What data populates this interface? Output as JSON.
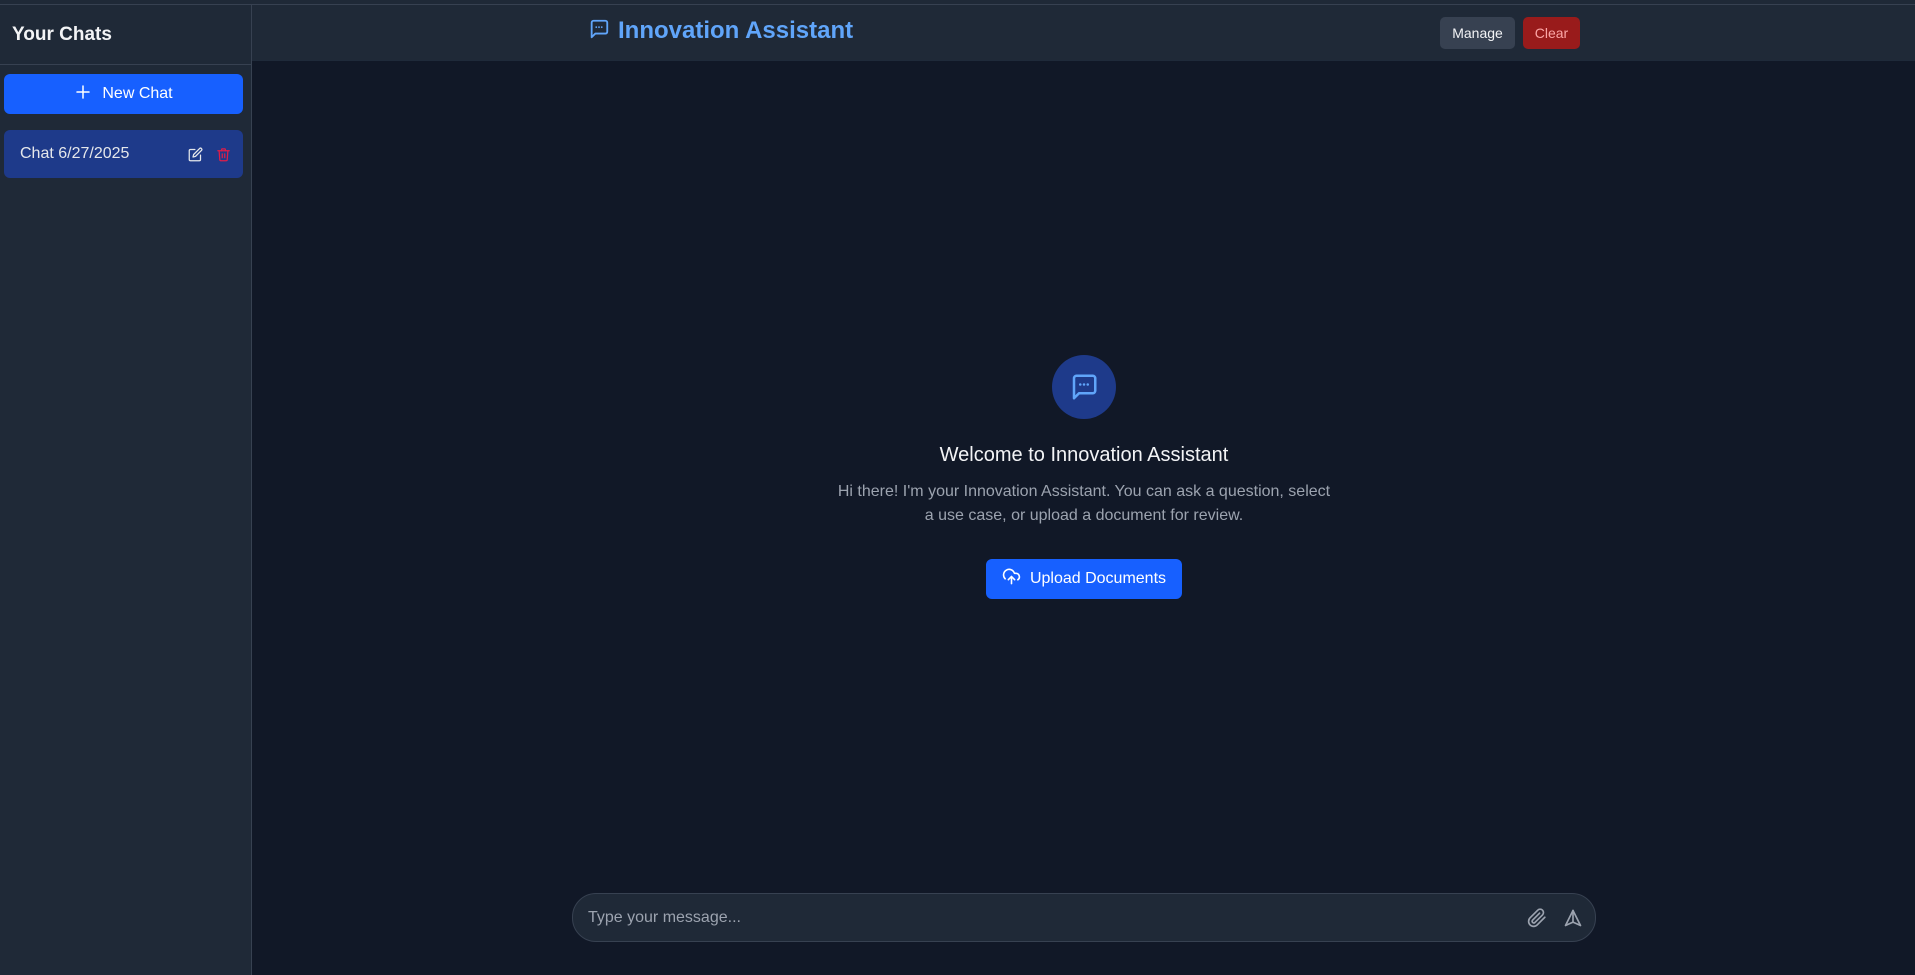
{
  "sidebar": {
    "title": "Your Chats",
    "new_chat_label": "New Chat",
    "chats": [
      {
        "label": "Chat 6/27/2025"
      }
    ]
  },
  "header": {
    "title": "Innovation Assistant",
    "manage_label": "Manage",
    "clear_label": "Clear"
  },
  "welcome": {
    "title": "Welcome to Innovation Assistant",
    "text": "Hi there! I'm your Innovation Assistant. You can ask a question, select a use case, or upload a document for review.",
    "upload_label": "Upload Documents"
  },
  "composer": {
    "placeholder": "Type your message..."
  },
  "icons": {
    "chat": "chat-bubble-icon",
    "plus": "plus-icon",
    "edit": "edit-icon",
    "delete": "trash-icon",
    "upload": "cloud-upload-icon",
    "attach": "paperclip-icon",
    "send": "send-icon"
  },
  "colors": {
    "accent": "#1760ff",
    "title": "#60a5fa",
    "danger": "#991b1b",
    "delete_icon": "#e11d48"
  }
}
